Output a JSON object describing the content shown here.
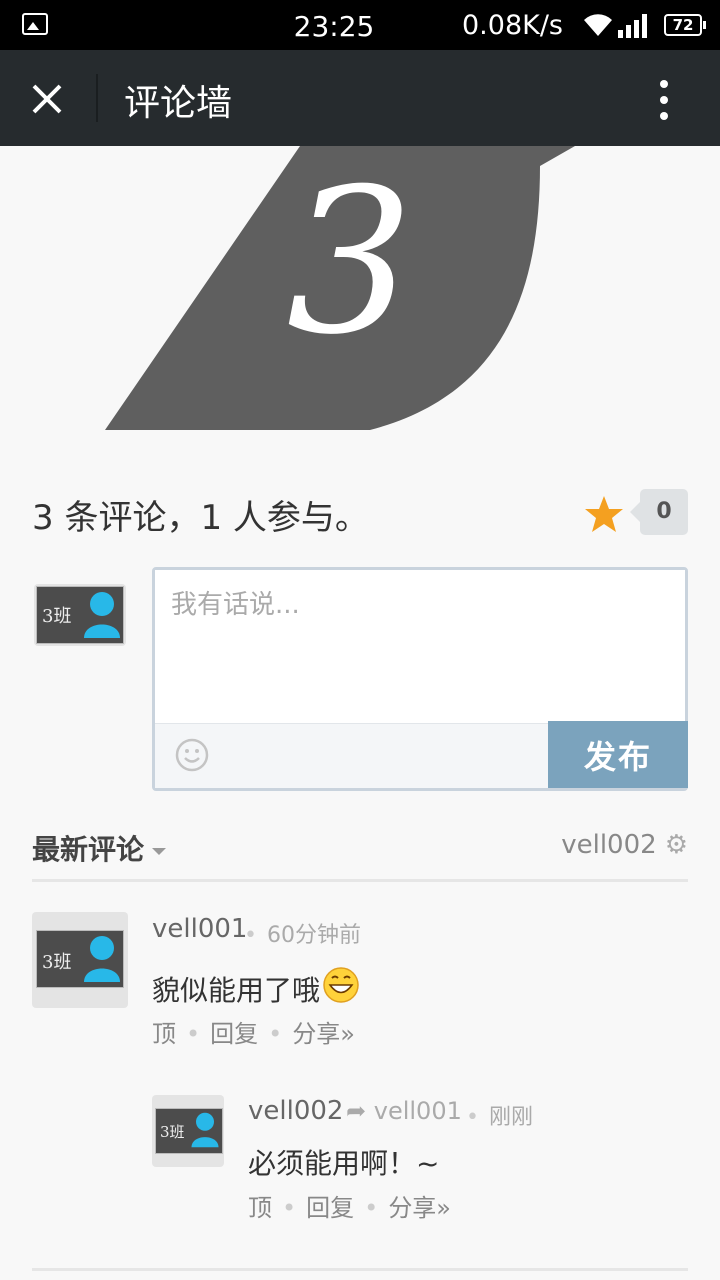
{
  "status_bar": {
    "time": "23:25",
    "speed": "0.08K/s",
    "battery": "72"
  },
  "header": {
    "title": "评论墙"
  },
  "banner": {
    "text": "3"
  },
  "summary": {
    "text": "3 条评论，1 人参与。",
    "star_count": "0"
  },
  "composer": {
    "avatar_label": "3班",
    "placeholder": "我有话说...",
    "publish_label": "发布"
  },
  "sort_bar": {
    "label": "最新评论",
    "current_user": "vell002"
  },
  "comments": [
    {
      "avatar_label": "3班",
      "author": "vell001",
      "time": "60分钟前",
      "text": "貌似能用了哦",
      "actions": [
        "顶",
        "回复",
        "分享»"
      ]
    },
    {
      "avatar_label": "3班",
      "author": "vell002",
      "reply_to": "vell001",
      "time": "刚刚",
      "text": "必须能用啊！~",
      "actions": [
        "顶",
        "回复",
        "分享»"
      ]
    }
  ],
  "colors": {
    "topbar": "#262b2e",
    "publish_button": "#7ba3bd",
    "star": "#f4a020",
    "banner": "#5f5f5f"
  }
}
